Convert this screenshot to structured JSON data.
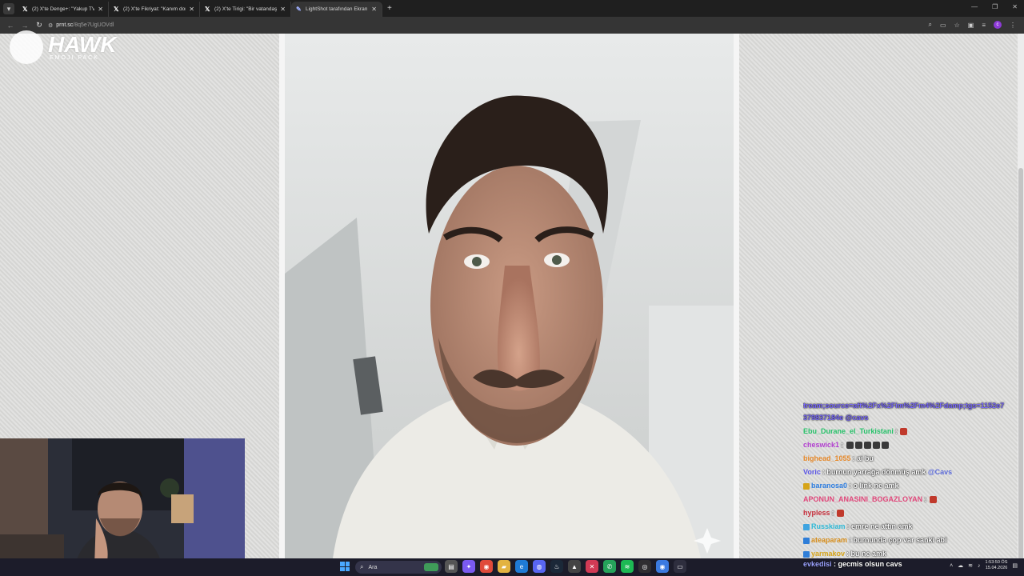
{
  "browser": {
    "tabs": [
      {
        "icon": "x-logo-icon",
        "title": "(2) X'te Denge+: \"Yakup TV'nin",
        "active": false
      },
      {
        "icon": "x-logo-icon",
        "title": "(2) X'te Fikriyat: \"Kanım donduı",
        "active": false
      },
      {
        "icon": "x-logo-icon",
        "title": "(2) X'te Tirigi: \"Bir vatandaş, Han",
        "active": false
      },
      {
        "icon": "feather-icon",
        "title": "LightShot tarafından Ekran Gö",
        "active": true
      }
    ],
    "new_tab_glyph": "+",
    "url_domain": "prnt.sc",
    "url_path": "/8q5e7UgUOVdl"
  },
  "watermark": {
    "name": "HAWK",
    "sub": "EMOJI PACK"
  },
  "chat": {
    "messages": [
      {
        "user": "",
        "user_color": "#7b6bff",
        "text": "tream;source=aft%2Fx%2Fim%2Fm4%2Fdamp;tgs=1152e7"
      },
      {
        "user": "",
        "user_color": "#7b6bff",
        "text": "379837184e @cavs"
      },
      {
        "user": "Ebu_Durane_el_Turkistani",
        "user_color": "#28c26a",
        "text": ":",
        "emote": "#c0392b"
      },
      {
        "user": "cheswick1",
        "user_color": "#b23fd0",
        "text": ":",
        "emotes_count": 5
      },
      {
        "user": "bighead_1055",
        "user_color": "#e6892b",
        "text": ": ai bu"
      },
      {
        "user": "Voric",
        "user_color": "#5b56e6",
        "text": ": burnun yarrağa dönmüş amk",
        "mention": "@Cavs"
      },
      {
        "user": "baranosa0",
        "user_color": "#2d7de0",
        "text": ": o link ne amk",
        "badge": "#d6a419"
      },
      {
        "user": "APONUN_ANASINI_BOGAZLOYAN",
        "user_color": "#e0477a",
        "text": ":",
        "emote": "#c0392b"
      },
      {
        "user": "hypless",
        "user_color": "#c62d3a",
        "text": ":",
        "emote": "#c0392b"
      },
      {
        "user": "Russkiam",
        "user_color": "#2fb9d7",
        "text": ": emre ne attın amk",
        "badge": "#3fa4e0"
      },
      {
        "user": "ateaparam",
        "user_color": "#d68d1b",
        "text": ": burnunda çop var sanki abi",
        "badge": "#2f7ed8"
      },
      {
        "user": "yarmakov",
        "user_color": "#d6a419",
        "text": ": bu ne amk",
        "badge": "#2f7ed8"
      }
    ],
    "input_user": "evkedisi",
    "input_text": ": gecmis olsun cavs"
  },
  "taskbar": {
    "search_placeholder": "Ara",
    "apps": [
      "file-explorer-icon",
      "copilot-icon",
      "chrome-icon",
      "folder-icon",
      "edge-icon",
      "discord-icon",
      "steam-icon",
      "game-icon",
      "app-red-icon",
      "whatsapp-icon",
      "spotify-icon",
      "obs-icon",
      "chrome-alt-icon",
      "terminal-icon"
    ],
    "time": "1:53:50 ÖS",
    "date": "15.04.2026"
  }
}
